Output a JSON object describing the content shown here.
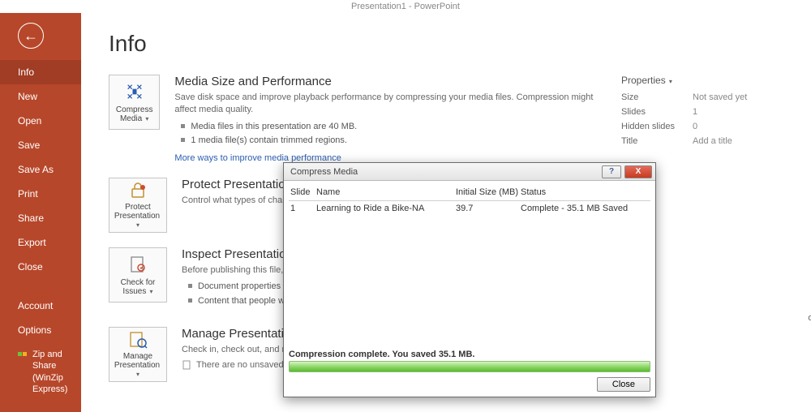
{
  "app_title": "Presentation1 - PowerPoint",
  "page_title": "Info",
  "sidebar": {
    "items": [
      "Info",
      "New",
      "Open",
      "Save",
      "Save As",
      "Print",
      "Share",
      "Export",
      "Close"
    ],
    "secondary": [
      "Account",
      "Options"
    ],
    "zip_label": "Zip and Share (WinZip Express)"
  },
  "sections": {
    "media": {
      "btn": "Compress Media",
      "title": "Media Size and Performance",
      "desc": "Save disk space and improve playback performance by compressing your media files. Compression might affect media quality.",
      "bullets": [
        "Media files in this presentation are 40 MB.",
        "1 media file(s) contain trimmed regions."
      ],
      "link": "More ways to improve media performance"
    },
    "protect": {
      "btn": "Protect Presentation",
      "title": "Protect Presentatio",
      "desc": "Control what types of chang"
    },
    "inspect": {
      "btn": "Check for Issues",
      "title": "Inspect Presentatio",
      "desc": "Before publishing this file, b",
      "bullets": [
        "Document properties a",
        "Content that people wi"
      ]
    },
    "manage": {
      "btn": "Manage Presentation",
      "title": "Manage Presentati",
      "desc": "Check in, check out, and re",
      "sub": "There are no unsaved"
    }
  },
  "props": {
    "heading": "Properties",
    "rows": [
      {
        "label": "Size",
        "value": "Not saved yet"
      },
      {
        "label": "Slides",
        "value": "1"
      },
      {
        "label": "Hidden slides",
        "value": "0"
      },
      {
        "label": "Title",
        "value": "Add a title"
      }
    ]
  },
  "box_fragment": "ox",
  "dialog": {
    "title": "Compress Media",
    "headers": {
      "slide": "Slide",
      "name": "Name",
      "size": "Initial Size (MB)",
      "status": "Status"
    },
    "rows": [
      {
        "slide": "1",
        "name": "Learning to Ride a Bike-NA",
        "size": "39.7",
        "status": "Complete - 35.1 MB Saved"
      }
    ],
    "progress_text": "Compression complete. You saved 35.1 MB.",
    "close_btn": "Close"
  }
}
